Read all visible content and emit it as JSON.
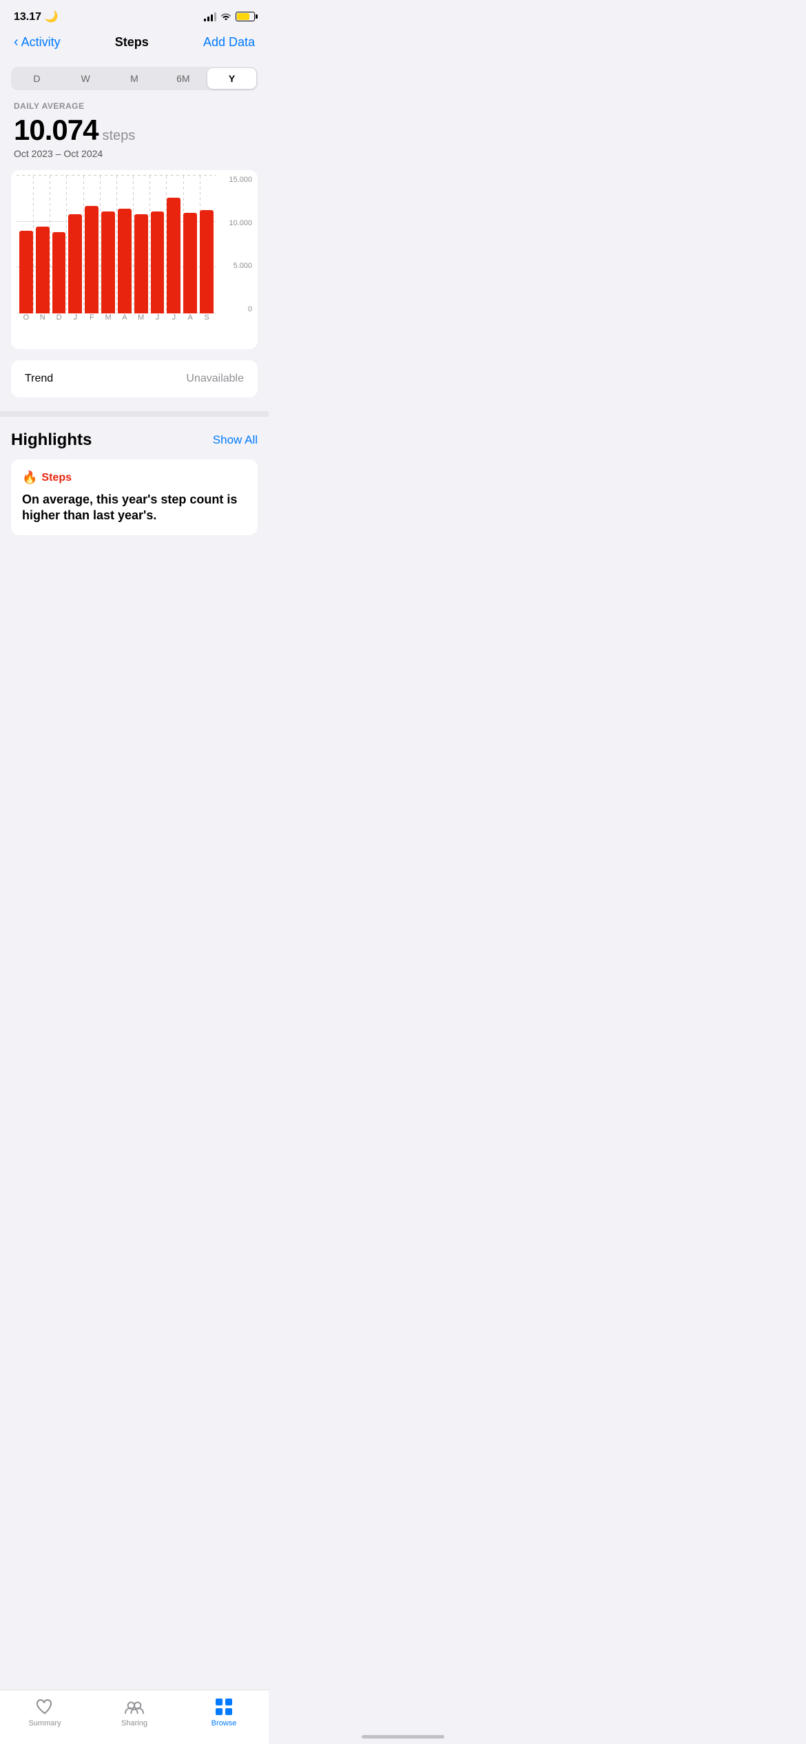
{
  "statusBar": {
    "time": "13.17",
    "moonIcon": "🌙"
  },
  "header": {
    "backLabel": "Activity",
    "title": "Steps",
    "actionLabel": "Add Data"
  },
  "periodSelector": {
    "options": [
      "D",
      "W",
      "M",
      "6M",
      "Y"
    ],
    "activeIndex": 4
  },
  "stats": {
    "label": "DAILY AVERAGE",
    "value": "10.074",
    "unit": "steps",
    "dateRange": "Oct 2023 – Oct 2024"
  },
  "chart": {
    "yLabels": [
      "15.000",
      "10.000",
      "5.000",
      "0"
    ],
    "xLabels": [
      "O",
      "N",
      "D",
      "J",
      "F",
      "M",
      "A",
      "M",
      "J",
      "J",
      "A",
      "S"
    ],
    "bars": [
      {
        "label": "O",
        "heightPct": 60
      },
      {
        "label": "N",
        "heightPct": 63
      },
      {
        "label": "D",
        "heightPct": 59
      },
      {
        "label": "J",
        "heightPct": 72
      },
      {
        "label": "F",
        "heightPct": 78
      },
      {
        "label": "M",
        "heightPct": 74
      },
      {
        "label": "A",
        "heightPct": 76
      },
      {
        "label": "M",
        "heightPct": 72
      },
      {
        "label": "J",
        "heightPct": 74
      },
      {
        "label": "J",
        "heightPct": 84
      },
      {
        "label": "A",
        "heightPct": 73
      },
      {
        "label": "S",
        "heightPct": 75
      }
    ]
  },
  "trend": {
    "label": "Trend",
    "value": "Unavailable"
  },
  "highlights": {
    "title": "Highlights",
    "showAllLabel": "Show All",
    "cards": [
      {
        "icon": "🔥",
        "titleColor": "#e8240e",
        "cardTitle": "Steps",
        "cardText": "On average, this year's step count is higher than last year's."
      }
    ]
  },
  "tabBar": {
    "tabs": [
      {
        "label": "Summary",
        "active": false
      },
      {
        "label": "Sharing",
        "active": false
      },
      {
        "label": "Browse",
        "active": true
      }
    ]
  }
}
